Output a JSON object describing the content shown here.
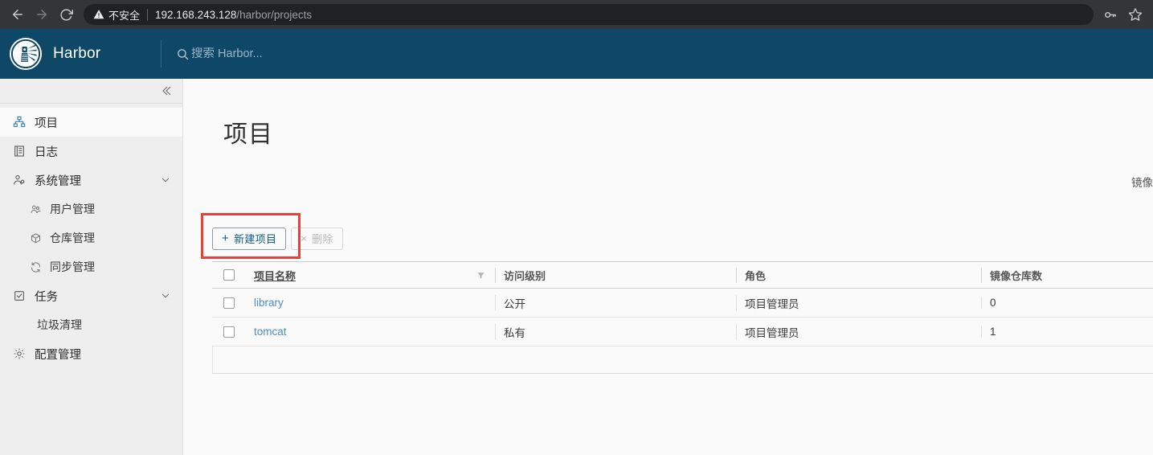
{
  "browser": {
    "back_icon": "back-arrow-icon",
    "forward_icon": "forward-arrow-icon",
    "reload_icon": "reload-icon",
    "security_label": "不安全",
    "url_host": "192.168.243.128",
    "url_path": "/harbor/projects",
    "key_icon": "key-icon",
    "star_icon": "star-icon"
  },
  "header": {
    "brand": "Harbor",
    "logo_icon": "harbor-lighthouse-logo",
    "search_placeholder": "搜索 Harbor...",
    "search_value": "",
    "background": "#0f4866"
  },
  "sidebar": {
    "collapse_icon": "double-chevron-left-icon",
    "items": [
      {
        "label": "项目",
        "icon": "projects-icon",
        "active": true
      },
      {
        "label": "日志",
        "icon": "logs-icon",
        "active": false
      },
      {
        "label": "系统管理",
        "icon": "system-admin-icon",
        "expandable": true
      },
      {
        "label": "用户管理",
        "icon": "users-icon",
        "sub": true
      },
      {
        "label": "仓库管理",
        "icon": "registry-icon",
        "sub": true
      },
      {
        "label": "同步管理",
        "icon": "replication-icon",
        "sub": true
      },
      {
        "label": "任务",
        "icon": "tasks-icon",
        "expandable": true
      },
      {
        "label": "垃圾清理",
        "icon": "",
        "sub": true
      },
      {
        "label": "配置管理",
        "icon": "gear-icon",
        "active": false
      }
    ]
  },
  "main": {
    "title": "项目",
    "clipped_right_label": "镜像",
    "new_project_label": "新建项目",
    "new_project_plus": "+",
    "delete_label": "删除",
    "delete_times": "×",
    "highlight_color": "#e8413c"
  },
  "table": {
    "columns": [
      "项目名称",
      "访问级别",
      "角色",
      "镜像仓库数"
    ],
    "sort_column": "项目名称",
    "filter_icon": "filter-icon",
    "rows": [
      {
        "name": "library",
        "access": "公开",
        "role": "项目管理员",
        "repos": "0",
        "checked": false
      },
      {
        "name": "tomcat",
        "access": "私有",
        "role": "项目管理员",
        "repos": "1",
        "checked": false
      }
    ]
  }
}
